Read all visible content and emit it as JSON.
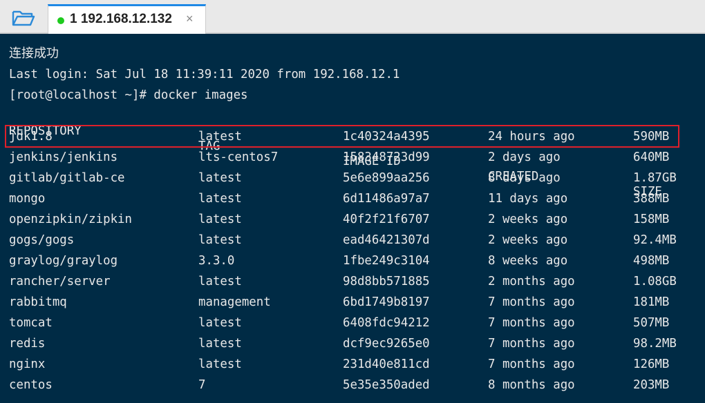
{
  "tab": {
    "title": "1 192.168.12.132",
    "close": "×",
    "status_color": "#1ecb1e"
  },
  "terminal": {
    "lines": [
      "连接成功",
      "Last login: Sat Jul 18 11:39:11 2020 from 192.168.12.1",
      "[root@localhost ~]# docker images"
    ],
    "headers": [
      "REPOSITORY",
      "TAG",
      "IMAGE ID",
      "CREATED",
      "SIZE"
    ],
    "rows": [
      [
        "jdk1.8",
        "latest",
        "1c40324a4395",
        "24 hours ago",
        "590MB"
      ],
      [
        "jenkins/jenkins",
        "lts-centos7",
        "158348723d99",
        "2 days ago",
        "640MB"
      ],
      [
        "gitlab/gitlab-ce",
        "latest",
        "5e6e899aa256",
        "8 days ago",
        "1.87GB"
      ],
      [
        "mongo",
        "latest",
        "6d11486a97a7",
        "11 days ago",
        "388MB"
      ],
      [
        "openzipkin/zipkin",
        "latest",
        "40f2f21f6707",
        "2 weeks ago",
        "158MB"
      ],
      [
        "gogs/gogs",
        "latest",
        "ead46421307d",
        "2 weeks ago",
        "92.4MB"
      ],
      [
        "graylog/graylog",
        "3.3.0",
        "1fbe249c3104",
        "8 weeks ago",
        "498MB"
      ],
      [
        "rancher/server",
        "latest",
        "98d8bb571885",
        "2 months ago",
        "1.08GB"
      ],
      [
        "rabbitmq",
        "management",
        "6bd1749b8197",
        "7 months ago",
        "181MB"
      ],
      [
        "tomcat",
        "latest",
        "6408fdc94212",
        "7 months ago",
        "507MB"
      ],
      [
        "redis",
        "latest",
        "dcf9ec9265e0",
        "7 months ago",
        "98.2MB"
      ],
      [
        "nginx",
        "latest",
        "231d40e811cd",
        "7 months ago",
        "126MB"
      ],
      [
        "centos",
        "7",
        "5e35e350aded",
        "8 months ago",
        "203MB"
      ]
    ],
    "highlight_color": "#e0202a"
  }
}
